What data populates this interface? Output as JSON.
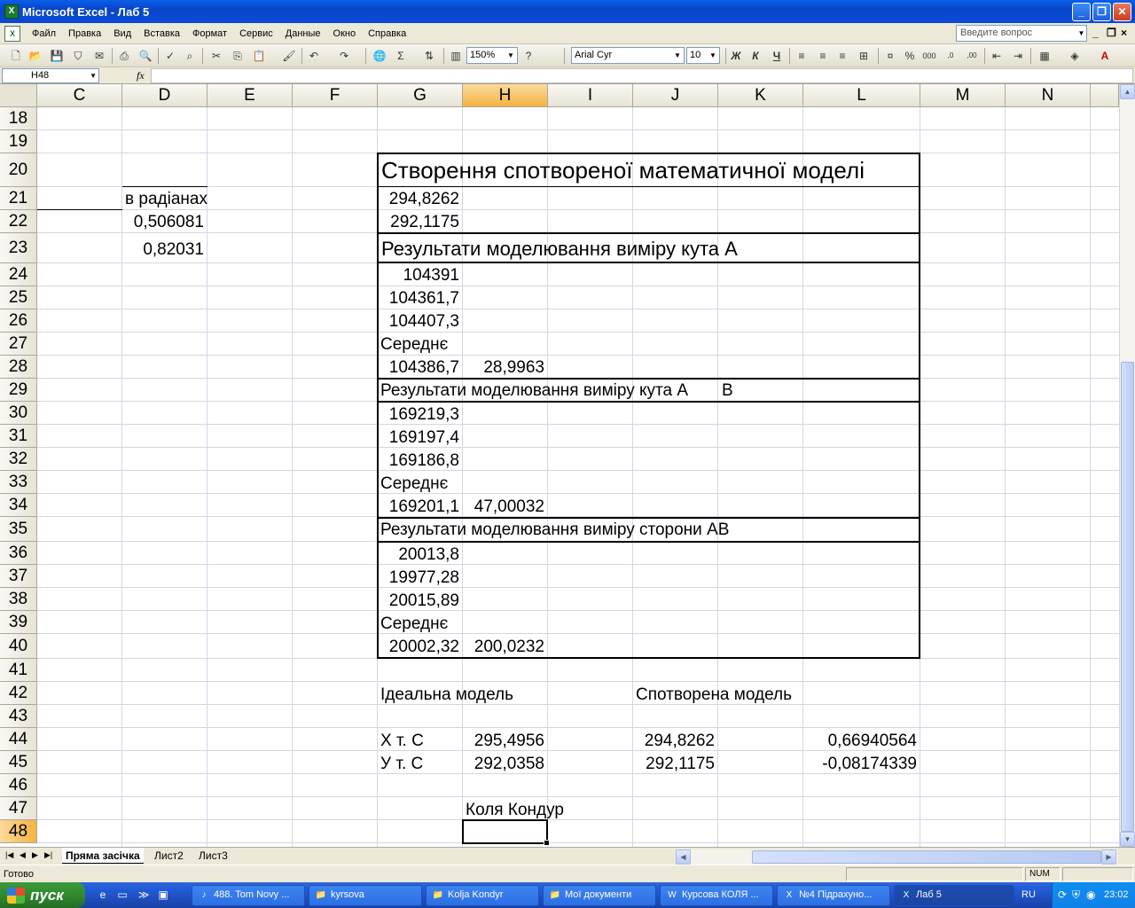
{
  "window": {
    "title": "Microsoft Excel - Лаб 5",
    "buttons": [
      "_",
      "❐",
      "✕"
    ]
  },
  "menu": {
    "items": [
      "Файл",
      "Правка",
      "Вид",
      "Вставка",
      "Формат",
      "Сервис",
      "Данные",
      "Окно",
      "Справка"
    ],
    "help_placeholder": "Введите вопрос"
  },
  "toolbar": {
    "zoom": "150%",
    "font": "Arial Cyr",
    "font_size": "10",
    "bold_label": "Ж",
    "italic_label": "К",
    "underline_label": "Ч"
  },
  "formula_bar": {
    "name_box": "H48",
    "fx_label": "fx",
    "formula": ""
  },
  "columns": [
    "C",
    "D",
    "E",
    "F",
    "G",
    "H",
    "I",
    "J",
    "K",
    "L",
    "M",
    "N"
  ],
  "selected_column": "H",
  "rows": [
    "18",
    "19",
    "20",
    "21",
    "22",
    "23",
    "24",
    "25",
    "26",
    "27",
    "28",
    "29",
    "30",
    "31",
    "32",
    "33",
    "34",
    "35",
    "36",
    "37",
    "38",
    "39",
    "40",
    "41",
    "42",
    "43",
    "44",
    "45",
    "46",
    "47",
    "48"
  ],
  "selected_row": "48",
  "cells": {
    "D21": "в радіанах",
    "D22": "0,506081",
    "D23": "0,82031",
    "G20": "Створення спотвореної математичної моделі",
    "G21": "294,8262",
    "G22": "292,1175",
    "G23": "Результати моделювання виміру кута А",
    "G24": "104391",
    "G25": "104361,7",
    "G26": "104407,3",
    "G27": "Середнє",
    "G28": "104386,7",
    "H28": "28,9963",
    "G29": "Результати моделювання виміру кута А",
    "K29": "В",
    "G30": "169219,3",
    "G31": "169197,4",
    "G32": "169186,8",
    "G33": "Середнє",
    "G34": "169201,1",
    "H34": "47,00032",
    "G35": "Результати моделювання виміру сторони АВ",
    "G36": "20013,8",
    "G37": "19977,28",
    "G38": "20015,89",
    "G39": "Середнє",
    "G40": "20002,32",
    "H40": "200,0232",
    "G42": "Ідеальна модель",
    "J42": "Спотворена модель",
    "G44": "Х т. С",
    "H44": "295,4956",
    "J44": "294,8262",
    "L44": "0,66940564",
    "G45": "У т. С",
    "H45": "292,0358",
    "J45": "292,1175",
    "L45": "-0,08174339",
    "H47": "Коля Кондур"
  },
  "sheets": [
    "Пряма засічка",
    "Лист2",
    "Лист3"
  ],
  "active_sheet": "Пряма засічка",
  "status": {
    "ready": "Готово",
    "num": "NUM"
  },
  "taskbar": {
    "start": "пуск",
    "tasks": [
      "488. Tom Novy ...",
      "kyrsova",
      "Kolja Kondyr",
      "Мої документи",
      "Курсова КОЛЯ ...",
      "№4 Підрахуно...",
      "Лаб 5"
    ],
    "lang": "RU",
    "clock": "23:02"
  }
}
